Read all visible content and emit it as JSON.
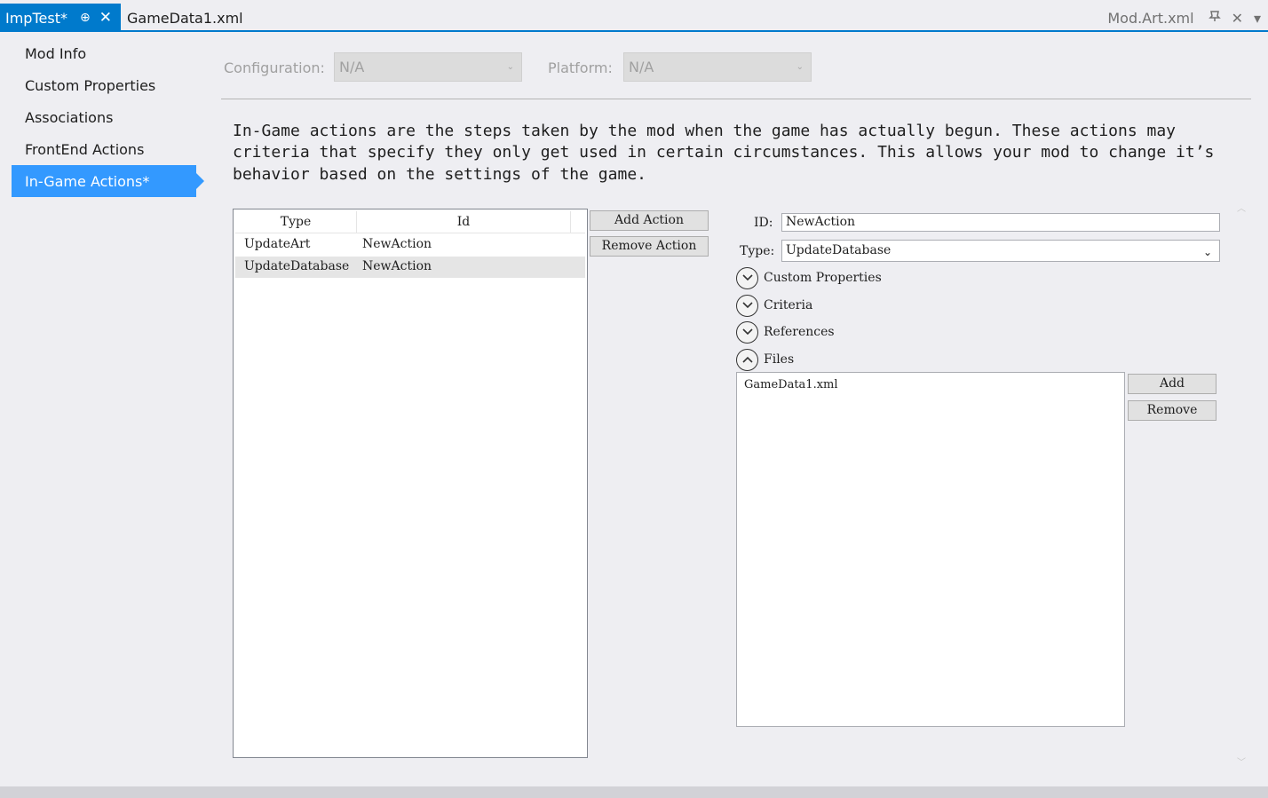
{
  "tabs": {
    "active": {
      "label": "ImpTest*",
      "pin_glyph": "⊕",
      "close_glyph": "✕"
    },
    "second": {
      "label": "GameData1.xml"
    },
    "right": {
      "label": "Mod.Art.xml",
      "pin_glyph": "📌",
      "close_glyph": "✕",
      "menu_glyph": "▾"
    }
  },
  "sidebar": {
    "items": [
      {
        "label": "Mod Info"
      },
      {
        "label": "Custom Properties"
      },
      {
        "label": "Associations"
      },
      {
        "label": "FrontEnd Actions"
      },
      {
        "label": "In-Game Actions*"
      }
    ]
  },
  "config": {
    "configuration_label": "Configuration:",
    "configuration_value": "N/A",
    "platform_label": "Platform:",
    "platform_value": "N/A"
  },
  "description": "In-Game actions are the steps taken by the mod when the game has actually begun.  These actions may criteria that specify they only get used in certain circumstances.  This allows your mod to change it’s behavior based on the settings of the game.",
  "actions": {
    "columns": [
      "Type",
      "Id"
    ],
    "rows": [
      {
        "type": "UpdateArt",
        "id": "NewAction"
      },
      {
        "type": "UpdateDatabase",
        "id": "NewAction"
      }
    ],
    "add_label": "Add Action",
    "remove_label": "Remove Action"
  },
  "detail": {
    "id_label": "ID:",
    "id_value": "NewAction",
    "type_label": "Type:",
    "type_value": "UpdateDatabase",
    "sections": [
      {
        "label": "Custom Properties",
        "state": "collapsed"
      },
      {
        "label": "Criteria",
        "state": "collapsed"
      },
      {
        "label": "References",
        "state": "collapsed"
      },
      {
        "label": "Files",
        "state": "expanded"
      }
    ],
    "files": [
      "GameData1.xml"
    ],
    "add_label": "Add",
    "remove_label": "Remove"
  },
  "colors": {
    "accent": "#007acc",
    "selection": "#3399ff"
  }
}
